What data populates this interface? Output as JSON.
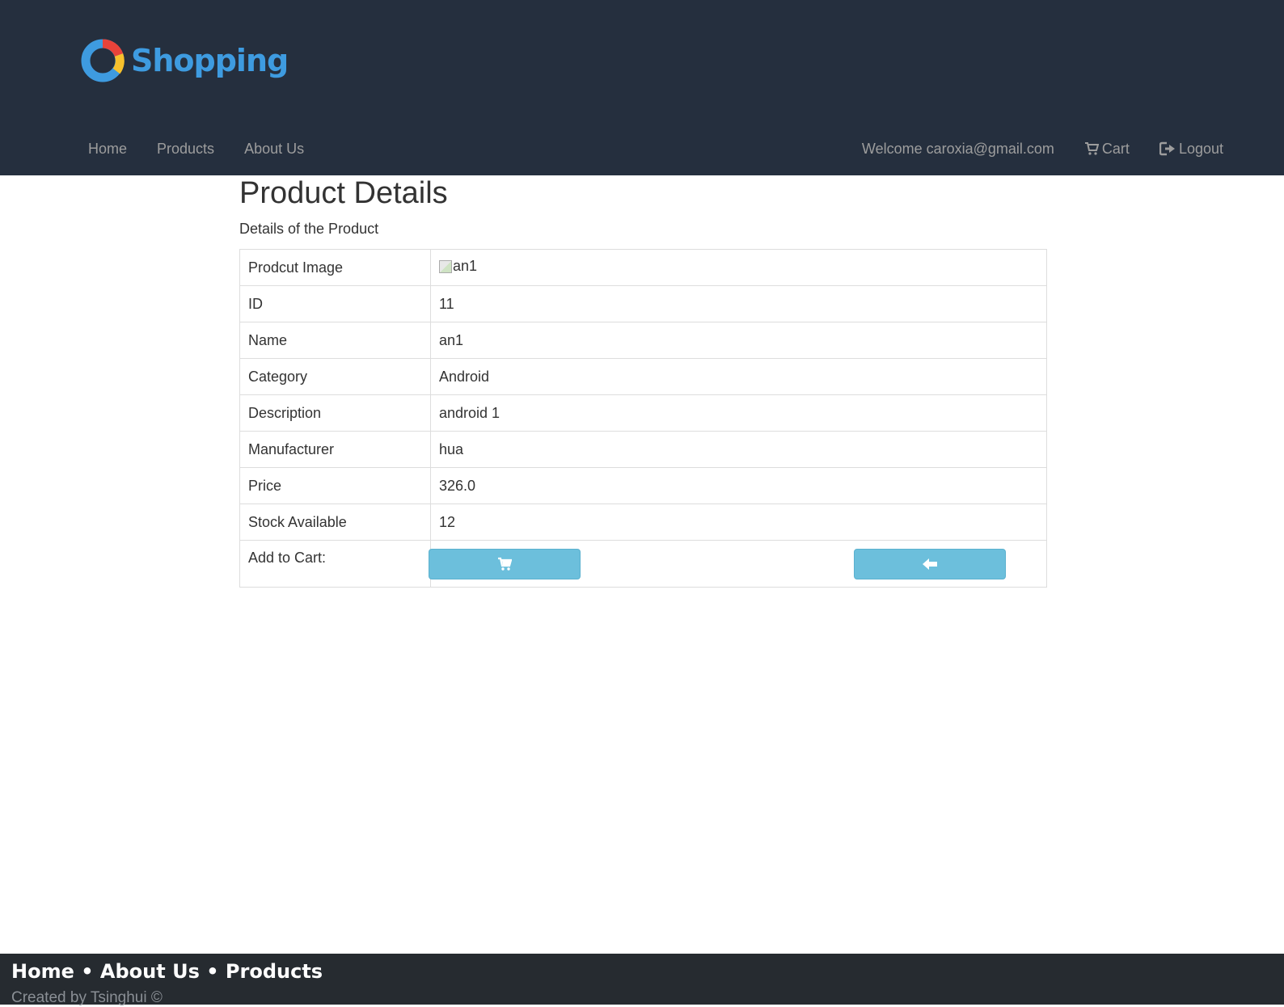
{
  "header": {
    "logo_text": "Shopping",
    "nav_left": [
      "Home",
      "Products",
      "About Us"
    ],
    "welcome": "Welcome caroxia@gmail.com",
    "cart": "Cart",
    "logout": "Logout"
  },
  "main": {
    "title": "Product Details",
    "subtitle": "Details of the Product",
    "rows": [
      {
        "label": "Prodcut Image",
        "value": "an1"
      },
      {
        "label": "ID",
        "value": "11"
      },
      {
        "label": "Name",
        "value": "an1"
      },
      {
        "label": "Category",
        "value": "Android"
      },
      {
        "label": "Description",
        "value": "android 1"
      },
      {
        "label": "Manufacturer",
        "value": "hua"
      },
      {
        "label": "Price",
        "value": "326.0"
      },
      {
        "label": "Stock Available",
        "value": "12"
      }
    ],
    "add_to_cart_label": "Add to Cart:",
    "add_cart_icon": "shopping-cart-icon",
    "back_icon": "arrow-left-icon"
  },
  "footer": {
    "links": [
      "Home",
      "About Us",
      "Products"
    ],
    "separator": "•",
    "copyright": "Created by Tsinghui ©"
  },
  "colors": {
    "header_bg": "#252f3e",
    "nav_text": "#9d9d9d",
    "logo_blue": "#3e9be0",
    "button_bg": "#6cbfdc",
    "footer_bg": "#262b30"
  }
}
